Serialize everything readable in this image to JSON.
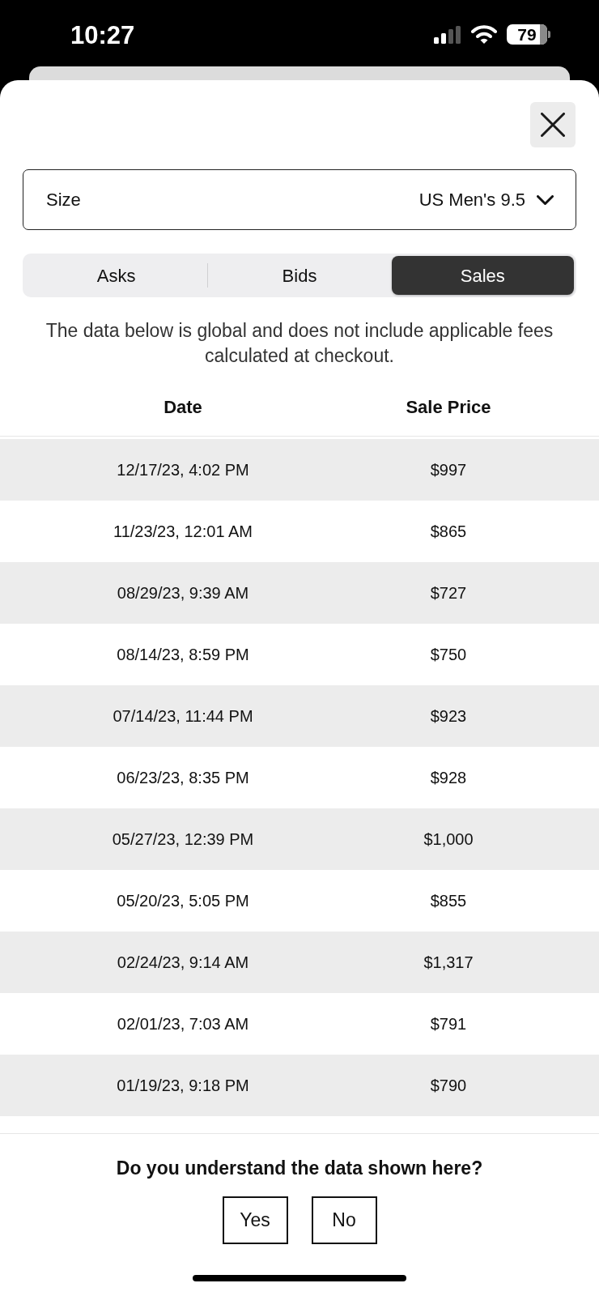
{
  "status_bar": {
    "time": "10:27",
    "battery": "79"
  },
  "size_select": {
    "label": "Size",
    "value": "US Men's 9.5"
  },
  "tabs": [
    {
      "label": "Asks",
      "selected": false
    },
    {
      "label": "Bids",
      "selected": false
    },
    {
      "label": "Sales",
      "selected": true
    }
  ],
  "notice": "The data below is global and does not include applicable fees calculated at checkout.",
  "table": {
    "columns": [
      "Date",
      "Sale Price"
    ],
    "rows": [
      [
        "12/17/23, 4:02 PM",
        "$997"
      ],
      [
        "11/23/23, 12:01 AM",
        "$865"
      ],
      [
        "08/29/23, 9:39 AM",
        "$727"
      ],
      [
        "08/14/23, 8:59 PM",
        "$750"
      ],
      [
        "07/14/23, 11:44 PM",
        "$923"
      ],
      [
        "06/23/23, 8:35 PM",
        "$928"
      ],
      [
        "05/27/23, 12:39 PM",
        "$1,000"
      ],
      [
        "05/20/23, 5:05 PM",
        "$855"
      ],
      [
        "02/24/23, 9:14 AM",
        "$1,317"
      ],
      [
        "02/01/23, 7:03 AM",
        "$791"
      ],
      [
        "01/19/23, 9:18 PM",
        "$790"
      ]
    ]
  },
  "feedback": {
    "question": "Do you understand the data shown here?",
    "buttons": [
      "Yes",
      "No"
    ]
  }
}
